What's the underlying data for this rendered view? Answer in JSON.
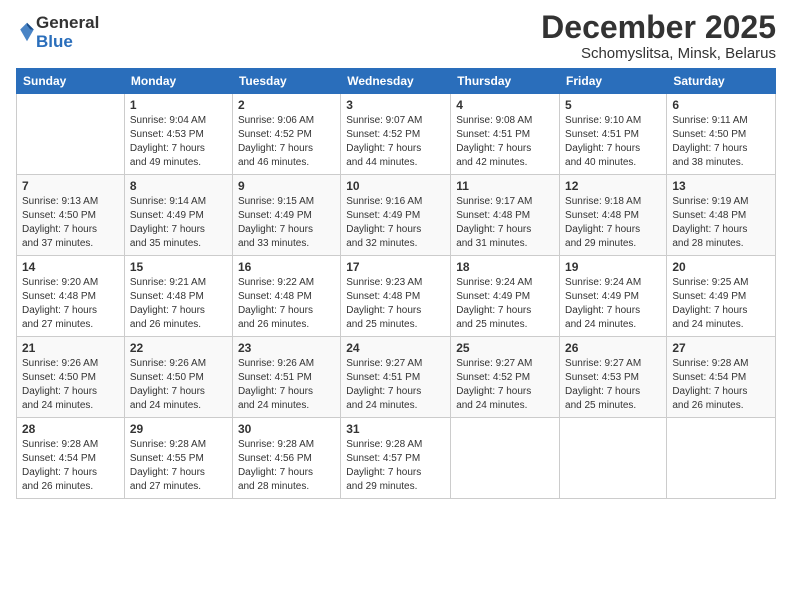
{
  "logo": {
    "general": "General",
    "blue": "Blue"
  },
  "header": {
    "month": "December 2025",
    "location": "Schomyslitsa, Minsk, Belarus"
  },
  "weekdays": [
    "Sunday",
    "Monday",
    "Tuesday",
    "Wednesday",
    "Thursday",
    "Friday",
    "Saturday"
  ],
  "weeks": [
    [
      {
        "day": "",
        "sunrise": "",
        "sunset": "",
        "daylight": ""
      },
      {
        "day": "1",
        "sunrise": "Sunrise: 9:04 AM",
        "sunset": "Sunset: 4:53 PM",
        "daylight": "Daylight: 7 hours and 49 minutes."
      },
      {
        "day": "2",
        "sunrise": "Sunrise: 9:06 AM",
        "sunset": "Sunset: 4:52 PM",
        "daylight": "Daylight: 7 hours and 46 minutes."
      },
      {
        "day": "3",
        "sunrise": "Sunrise: 9:07 AM",
        "sunset": "Sunset: 4:52 PM",
        "daylight": "Daylight: 7 hours and 44 minutes."
      },
      {
        "day": "4",
        "sunrise": "Sunrise: 9:08 AM",
        "sunset": "Sunset: 4:51 PM",
        "daylight": "Daylight: 7 hours and 42 minutes."
      },
      {
        "day": "5",
        "sunrise": "Sunrise: 9:10 AM",
        "sunset": "Sunset: 4:51 PM",
        "daylight": "Daylight: 7 hours and 40 minutes."
      },
      {
        "day": "6",
        "sunrise": "Sunrise: 9:11 AM",
        "sunset": "Sunset: 4:50 PM",
        "daylight": "Daylight: 7 hours and 38 minutes."
      }
    ],
    [
      {
        "day": "7",
        "sunrise": "Sunrise: 9:13 AM",
        "sunset": "Sunset: 4:50 PM",
        "daylight": "Daylight: 7 hours and 37 minutes."
      },
      {
        "day": "8",
        "sunrise": "Sunrise: 9:14 AM",
        "sunset": "Sunset: 4:49 PM",
        "daylight": "Daylight: 7 hours and 35 minutes."
      },
      {
        "day": "9",
        "sunrise": "Sunrise: 9:15 AM",
        "sunset": "Sunset: 4:49 PM",
        "daylight": "Daylight: 7 hours and 33 minutes."
      },
      {
        "day": "10",
        "sunrise": "Sunrise: 9:16 AM",
        "sunset": "Sunset: 4:49 PM",
        "daylight": "Daylight: 7 hours and 32 minutes."
      },
      {
        "day": "11",
        "sunrise": "Sunrise: 9:17 AM",
        "sunset": "Sunset: 4:48 PM",
        "daylight": "Daylight: 7 hours and 31 minutes."
      },
      {
        "day": "12",
        "sunrise": "Sunrise: 9:18 AM",
        "sunset": "Sunset: 4:48 PM",
        "daylight": "Daylight: 7 hours and 29 minutes."
      },
      {
        "day": "13",
        "sunrise": "Sunrise: 9:19 AM",
        "sunset": "Sunset: 4:48 PM",
        "daylight": "Daylight: 7 hours and 28 minutes."
      }
    ],
    [
      {
        "day": "14",
        "sunrise": "Sunrise: 9:20 AM",
        "sunset": "Sunset: 4:48 PM",
        "daylight": "Daylight: 7 hours and 27 minutes."
      },
      {
        "day": "15",
        "sunrise": "Sunrise: 9:21 AM",
        "sunset": "Sunset: 4:48 PM",
        "daylight": "Daylight: 7 hours and 26 minutes."
      },
      {
        "day": "16",
        "sunrise": "Sunrise: 9:22 AM",
        "sunset": "Sunset: 4:48 PM",
        "daylight": "Daylight: 7 hours and 26 minutes."
      },
      {
        "day": "17",
        "sunrise": "Sunrise: 9:23 AM",
        "sunset": "Sunset: 4:48 PM",
        "daylight": "Daylight: 7 hours and 25 minutes."
      },
      {
        "day": "18",
        "sunrise": "Sunrise: 9:24 AM",
        "sunset": "Sunset: 4:49 PM",
        "daylight": "Daylight: 7 hours and 25 minutes."
      },
      {
        "day": "19",
        "sunrise": "Sunrise: 9:24 AM",
        "sunset": "Sunset: 4:49 PM",
        "daylight": "Daylight: 7 hours and 24 minutes."
      },
      {
        "day": "20",
        "sunrise": "Sunrise: 9:25 AM",
        "sunset": "Sunset: 4:49 PM",
        "daylight": "Daylight: 7 hours and 24 minutes."
      }
    ],
    [
      {
        "day": "21",
        "sunrise": "Sunrise: 9:26 AM",
        "sunset": "Sunset: 4:50 PM",
        "daylight": "Daylight: 7 hours and 24 minutes."
      },
      {
        "day": "22",
        "sunrise": "Sunrise: 9:26 AM",
        "sunset": "Sunset: 4:50 PM",
        "daylight": "Daylight: 7 hours and 24 minutes."
      },
      {
        "day": "23",
        "sunrise": "Sunrise: 9:26 AM",
        "sunset": "Sunset: 4:51 PM",
        "daylight": "Daylight: 7 hours and 24 minutes."
      },
      {
        "day": "24",
        "sunrise": "Sunrise: 9:27 AM",
        "sunset": "Sunset: 4:51 PM",
        "daylight": "Daylight: 7 hours and 24 minutes."
      },
      {
        "day": "25",
        "sunrise": "Sunrise: 9:27 AM",
        "sunset": "Sunset: 4:52 PM",
        "daylight": "Daylight: 7 hours and 24 minutes."
      },
      {
        "day": "26",
        "sunrise": "Sunrise: 9:27 AM",
        "sunset": "Sunset: 4:53 PM",
        "daylight": "Daylight: 7 hours and 25 minutes."
      },
      {
        "day": "27",
        "sunrise": "Sunrise: 9:28 AM",
        "sunset": "Sunset: 4:54 PM",
        "daylight": "Daylight: 7 hours and 26 minutes."
      }
    ],
    [
      {
        "day": "28",
        "sunrise": "Sunrise: 9:28 AM",
        "sunset": "Sunset: 4:54 PM",
        "daylight": "Daylight: 7 hours and 26 minutes."
      },
      {
        "day": "29",
        "sunrise": "Sunrise: 9:28 AM",
        "sunset": "Sunset: 4:55 PM",
        "daylight": "Daylight: 7 hours and 27 minutes."
      },
      {
        "day": "30",
        "sunrise": "Sunrise: 9:28 AM",
        "sunset": "Sunset: 4:56 PM",
        "daylight": "Daylight: 7 hours and 28 minutes."
      },
      {
        "day": "31",
        "sunrise": "Sunrise: 9:28 AM",
        "sunset": "Sunset: 4:57 PM",
        "daylight": "Daylight: 7 hours and 29 minutes."
      },
      {
        "day": "",
        "sunrise": "",
        "sunset": "",
        "daylight": ""
      },
      {
        "day": "",
        "sunrise": "",
        "sunset": "",
        "daylight": ""
      },
      {
        "day": "",
        "sunrise": "",
        "sunset": "",
        "daylight": ""
      }
    ]
  ]
}
